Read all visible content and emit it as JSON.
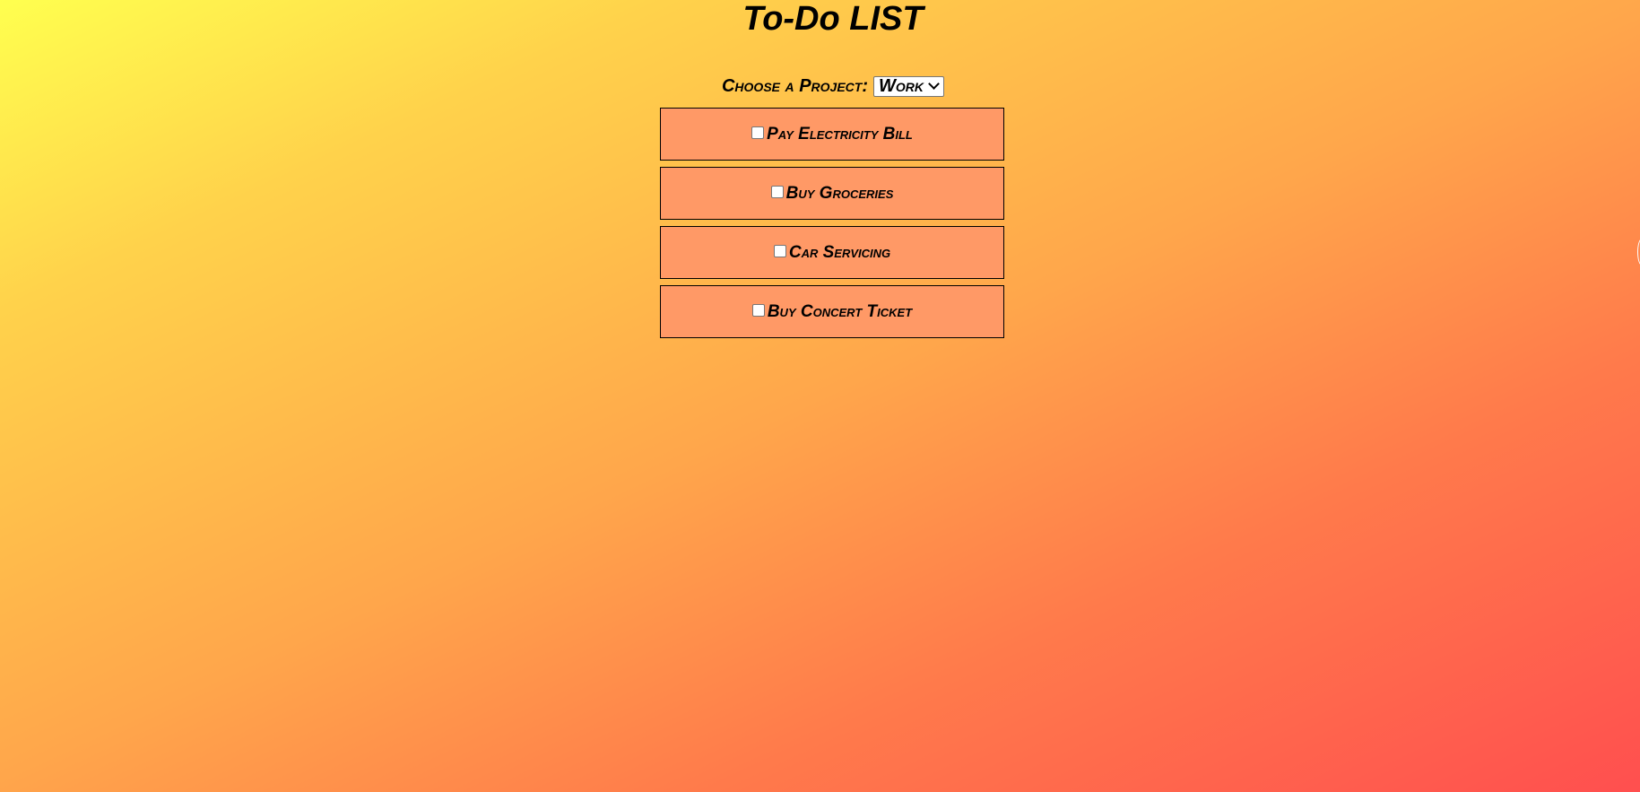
{
  "header": {
    "title": "To-Do LIST"
  },
  "project": {
    "label": "Choose a Project:",
    "selected": "Work"
  },
  "tasks": [
    {
      "label": "Pay Electricity Bill",
      "checked": false
    },
    {
      "label": "Buy Groceries",
      "checked": false
    },
    {
      "label": "Car Servicing",
      "checked": false
    },
    {
      "label": "Buy Concert Ticket",
      "checked": false
    }
  ],
  "colors": {
    "gradient_start": "#ffff4f",
    "gradient_end": "#ff4f4f",
    "task_background": "#ff9966",
    "task_border": "#000000"
  },
  "icons": {
    "select_arrow": "chevron-down-icon"
  }
}
